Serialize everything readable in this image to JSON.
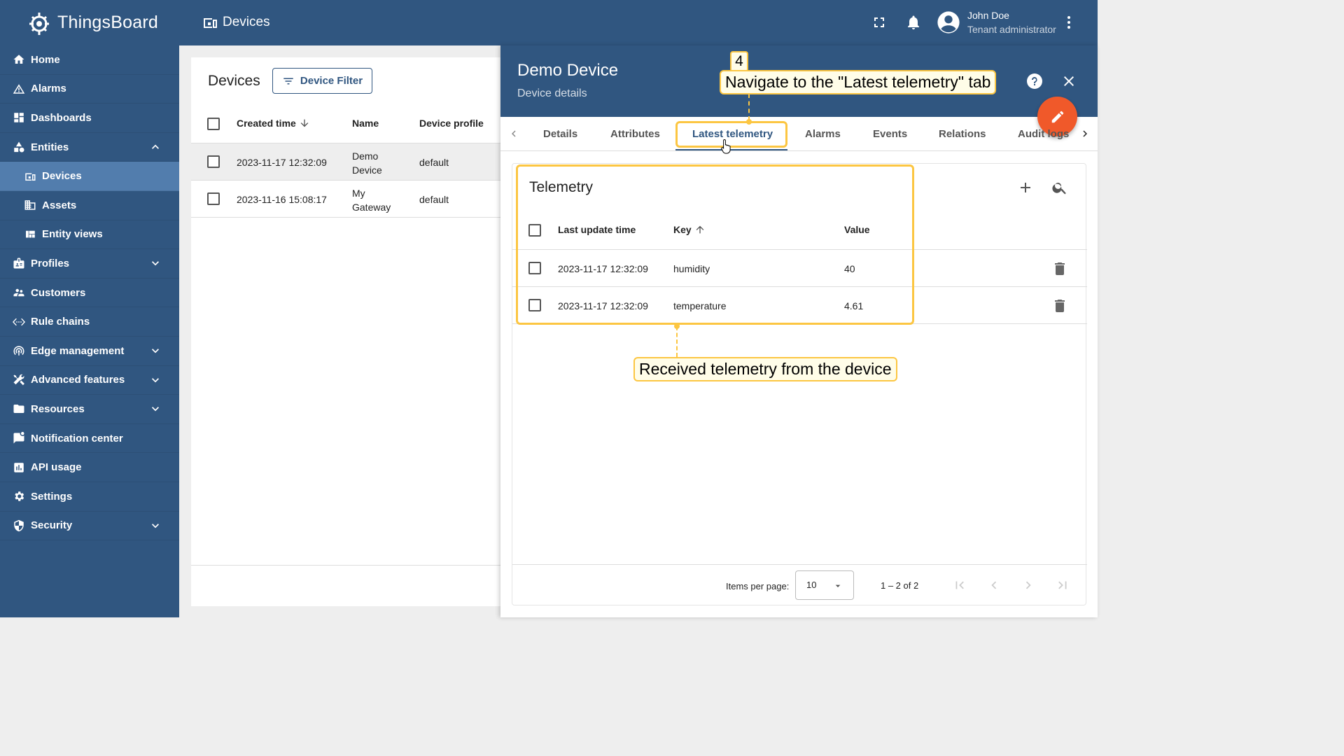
{
  "app": {
    "name": "ThingsBoard",
    "page_title": "Devices"
  },
  "user": {
    "name": "John Doe",
    "role": "Tenant administrator"
  },
  "sidebar": {
    "items": [
      {
        "label": "Home"
      },
      {
        "label": "Alarms"
      },
      {
        "label": "Dashboards"
      },
      {
        "label": "Entities"
      },
      {
        "label": "Devices"
      },
      {
        "label": "Assets"
      },
      {
        "label": "Entity views"
      },
      {
        "label": "Profiles"
      },
      {
        "label": "Customers"
      },
      {
        "label": "Rule chains"
      },
      {
        "label": "Edge management"
      },
      {
        "label": "Advanced features"
      },
      {
        "label": "Resources"
      },
      {
        "label": "Notification center"
      },
      {
        "label": "API usage"
      },
      {
        "label": "Settings"
      },
      {
        "label": "Security"
      }
    ]
  },
  "devices": {
    "heading": "Devices",
    "filter_label": "Device Filter",
    "columns": [
      "Created time",
      "Name",
      "Device profile"
    ],
    "rows": [
      {
        "created": "2023-11-17 12:32:09",
        "name_line1": "Demo",
        "name_line2": "Device",
        "profile": "default"
      },
      {
        "created": "2023-11-16 15:08:17",
        "name_line1": "My",
        "name_line2": "Gateway",
        "profile": "default"
      }
    ]
  },
  "drawer": {
    "title": "Demo Device",
    "subtitle": "Device details",
    "tabs": [
      "Details",
      "Attributes",
      "Latest telemetry",
      "Alarms",
      "Events",
      "Relations",
      "Audit logs"
    ],
    "active_tab": "Latest telemetry"
  },
  "telemetry": {
    "title": "Telemetry",
    "columns": [
      "Last update time",
      "Key",
      "Value"
    ],
    "rows": [
      {
        "time": "2023-11-17 12:32:09",
        "key": "humidity",
        "value": "40"
      },
      {
        "time": "2023-11-17 12:32:09",
        "key": "temperature",
        "value": "4.61"
      }
    ],
    "items_per_page_label": "Items per page:",
    "items_per_page": "10",
    "range": "1 – 2 of 2"
  },
  "annotations": {
    "step": "4",
    "tab_callout": "Navigate to the \"Latest telemetry\" tab",
    "table_callout": "Received telemetry from the device"
  },
  "colors": {
    "primary": "#305680",
    "sidebar_active": "#527dad",
    "accent": "#f0592a",
    "highlight": "#fcc642"
  }
}
